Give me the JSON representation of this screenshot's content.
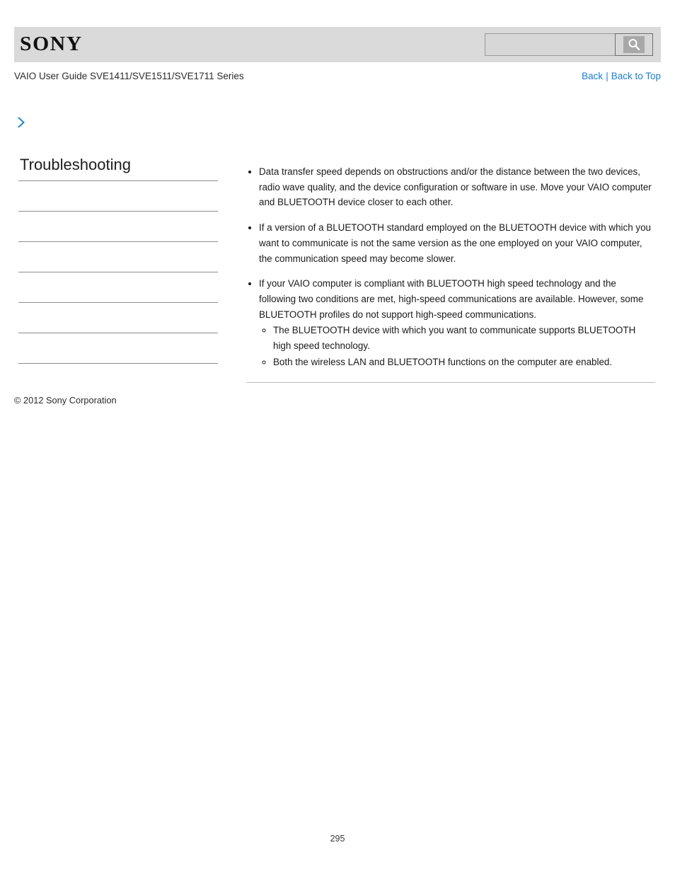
{
  "header": {
    "logo_text": "SONY",
    "search": {
      "value": "",
      "placeholder": "",
      "button_icon": "search-icon"
    }
  },
  "title_row": {
    "guide_title": "VAIO User Guide SVE1411/SVE1511/SVE1711 Series",
    "links": {
      "back": "Back",
      "separator": "|",
      "back_to_top": "Back to Top"
    }
  },
  "breadcrumb": {
    "icon": "chevron-right-icon",
    "label": ""
  },
  "sidebar": {
    "heading": "Troubleshooting",
    "items": [
      {
        "label": ""
      },
      {
        "label": ""
      },
      {
        "label": ""
      },
      {
        "label": ""
      },
      {
        "label": ""
      },
      {
        "label": ""
      }
    ]
  },
  "content": {
    "bullets": [
      {
        "text": "Data transfer speed depends on obstructions and/or the distance between the two devices, radio wave quality, and the device configuration or software in use. Move your VAIO computer and BLUETOOTH device closer to each other.",
        "sub": []
      },
      {
        "text": "If a version of a BLUETOOTH standard employed on the BLUETOOTH device with which you want to communicate is not the same version as the one employed on your VAIO computer, the communication speed may become slower.",
        "sub": []
      },
      {
        "text": "If your VAIO computer is compliant with BLUETOOTH high speed technology and the following two conditions are met, high-speed communications are available. However, some BLUETOOTH profiles do not support high-speed communications.",
        "sub": [
          "The BLUETOOTH device with which you want to communicate supports BLUETOOTH high speed technology.",
          "Both the wireless LAN and BLUETOOTH functions on the computer are enabled."
        ]
      }
    ]
  },
  "footer": {
    "copyright": "© 2012 Sony Corporation",
    "page_number": "295"
  },
  "colors": {
    "header_band": "#dadada",
    "link_blue": "#1a7fd4",
    "chevron_blue": "#2a8fd4",
    "rule_gray": "#8d8d8d"
  }
}
